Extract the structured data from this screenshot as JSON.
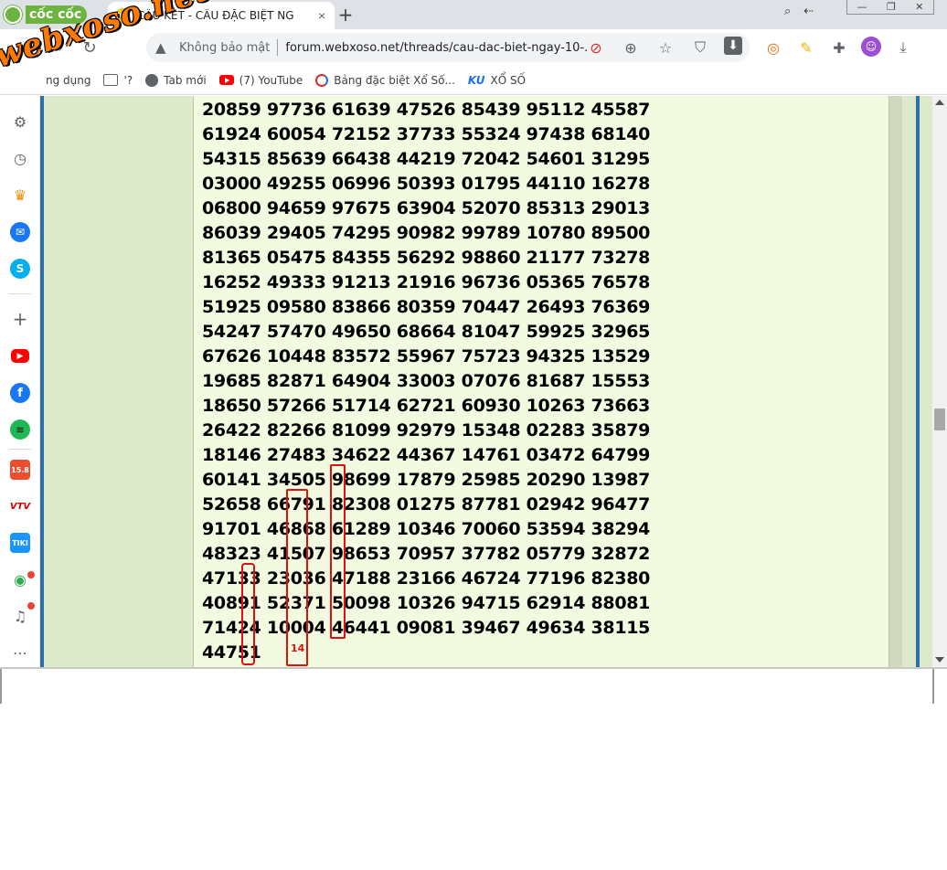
{
  "browser": {
    "brand": "cốc cốc",
    "tab": {
      "title": "CẦU KẾT - CẦU ĐẶC BIỆT NG",
      "favicon_text": "XS"
    },
    "security_text": "Không bảo mật",
    "url": "forum.webxoso.net/threads/cau-dac-biet-ngay-10-...",
    "icons": {
      "back": "←",
      "forward": "→",
      "reload": "↻",
      "warning": "▲",
      "block": "⊘",
      "zoom": "⊕",
      "star": "☆",
      "shield": "⛉",
      "download_page": "⬇",
      "coccoc": "◎",
      "pen": "✎",
      "puzzle": "✚",
      "avatar": "☺",
      "downloads": "⤓",
      "new_tab": "+",
      "tab_close": "×",
      "win_search": "⌕",
      "win_back": "⇠",
      "win_min": "—",
      "win_restore": "❐",
      "win_close": "✕"
    }
  },
  "bookmarks": [
    {
      "label": "ng dụng",
      "icon": "apps-icon"
    },
    {
      "label": "'?",
      "icon": "folder-icon"
    },
    {
      "label": "Tab mới",
      "icon": "globe-icon"
    },
    {
      "label": "(7) YouTube",
      "icon": "youtube-icon"
    },
    {
      "label": "Bảng đặc biệt Xổ Số...",
      "icon": "spin-icon"
    },
    {
      "label": "XỔ SỐ",
      "icon": "ku-icon",
      "prefix": "KU"
    }
  ],
  "watermark": "webxoso.net",
  "sidebar": {
    "icons": {
      "settings": "⚙",
      "history": "◷",
      "crown": "♛",
      "messenger": "✉",
      "skype": "S",
      "add": "+",
      "youtube": "▶",
      "facebook": "f",
      "spotify": "≋",
      "shop": "15.8",
      "vtv": "VTV",
      "tiki": "TIKI",
      "game": "◉",
      "bell": "♫",
      "more": "⋯"
    }
  },
  "lottery_rows": [
    "20859 97736 61639 47526 85439 95112 45587",
    "61924 60054 72152 37733 55324 97438 68140",
    "54315 85639 66438 44219 72042 54601 31295",
    "03000 49255 06996 50393 01795 44110 16278",
    "06800 94659 97675 63904 52070 85313 29013",
    "86039 29405 74295 90982 99789 10780 89500",
    "81365 05475 84355 56292 98860 21177 73278",
    "16252 49333 91213 21916 96736 05365 76578",
    "51925 09580 83866 80359 70447 26493 76369",
    "54247 57470 49650 68664 81047 59925 32965",
    "67626 10448 83572 55967 75723 94325 13529",
    "19685 82871 64904 33003 07076 81687 15553",
    "18650 57266 51714 62721 60930 10263 73663",
    "26422 82266 81099 92979 15348 02283 35879",
    "18146 27483 34622 44367 14761 03472 64799",
    "60141 34505 98699 17879 25985 20290 13987",
    "52658 66791 82308 01275 87781 02942 96477",
    "91701 46868 61289 10346 70060 53594 38294",
    "48323 41507 98653 70957 37782 05779 32872",
    "47133 23036 47188 23166 46724 77196 82380",
    "40891 52371 50098 10326 94715 62914 88081",
    "71424 10004 46441 09081 39467 49634 38115",
    "44751"
  ],
  "highlight_label": "14"
}
